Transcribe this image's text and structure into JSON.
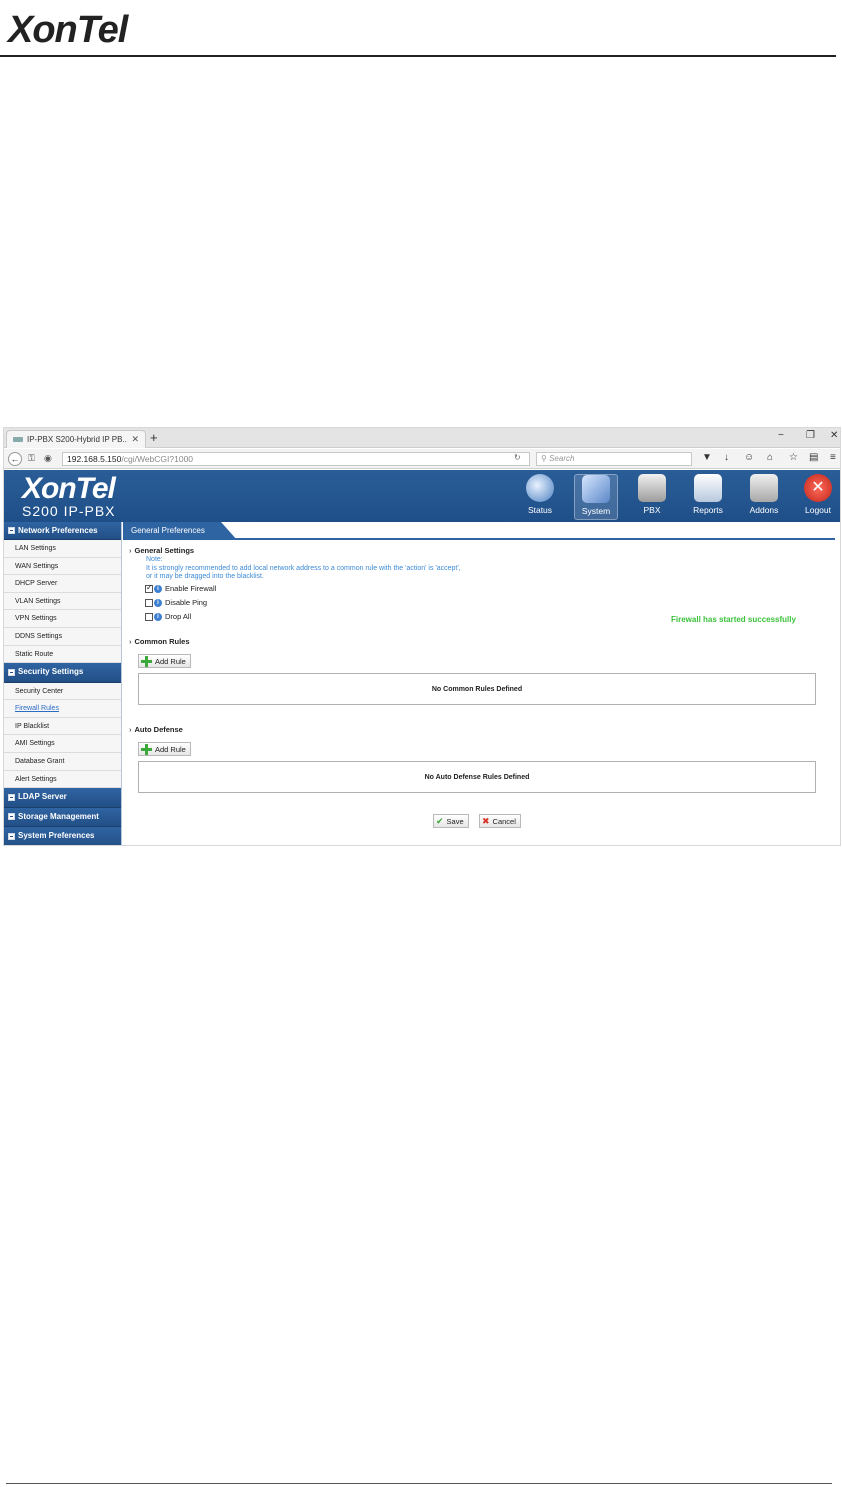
{
  "document": {
    "logo_text": "XonTel"
  },
  "browser": {
    "tab_title": "IP-PBX S200-Hybrid IP PB...",
    "tab_close": "✕",
    "new_tab": "+",
    "win_min": "−",
    "win_max": "❐",
    "win_close": "✕",
    "url_host": "192.168.5.150",
    "url_path": "/cgi/WebCGI?1000",
    "search_placeholder": "Search",
    "icons": [
      "back-arrow-icon",
      "key-icon",
      "globe-icon",
      "reload-icon",
      "search-icon",
      "pocket-icon",
      "download-icon",
      "chat-icon",
      "home-icon",
      "star-icon",
      "reading-list-icon",
      "menu-icon"
    ]
  },
  "app": {
    "logo_line1": "XonTel",
    "logo_line2": "S200 IP-PBX",
    "nav": [
      {
        "label": "Status",
        "icon": "status-icon"
      },
      {
        "label": "System",
        "icon": "system-icon"
      },
      {
        "label": "PBX",
        "icon": "pbx-icon"
      },
      {
        "label": "Reports",
        "icon": "reports-icon"
      },
      {
        "label": "Addons",
        "icon": "addons-icon"
      },
      {
        "label": "Logout",
        "icon": "logout-icon"
      }
    ],
    "active_nav": "System"
  },
  "sidebar": {
    "network_preferences": "Network Preferences",
    "network_items": [
      "LAN Settings",
      "WAN Settings",
      "DHCP Server",
      "VLAN Settings",
      "VPN Settings",
      "DDNS Settings",
      "Static Route"
    ],
    "security_settings": "Security Settings",
    "security_items": [
      "Security Center",
      "Firewall Rules",
      "IP Blacklist",
      "AMI Settings",
      "Database Grant",
      "Alert Settings"
    ],
    "active_item": "Firewall Rules",
    "ldap_server": "LDAP Server",
    "storage_management": "Storage Management",
    "system_preferences": "System Preferences"
  },
  "content": {
    "breadcrumb": "General Preferences",
    "general_settings": "General Settings",
    "note_label": "Note:",
    "note_line1": "It is strongly recommended to add local network address to a common rule with the 'action' is 'accept',",
    "note_line2": "or it may be dragged into the blacklist.",
    "enable_firewall": "Enable Firewall",
    "disable_ping": "Disable Ping",
    "drop_all": "Drop All",
    "enable_firewall_checked": true,
    "disable_ping_checked": false,
    "drop_all_checked": false,
    "status_message": "Firewall has started successfully",
    "common_rules": "Common Rules",
    "add_rule": "Add Rule",
    "no_common_rules": "No Common Rules Defined",
    "auto_defense": "Auto Defense",
    "no_auto_defense_rules": "No Auto Defense Rules Defined",
    "save": "Save",
    "cancel": "Cancel"
  },
  "colors": {
    "header_blue": "#1f4f88",
    "success_green": "#3bc23b",
    "note_blue": "#3d8ad6"
  }
}
